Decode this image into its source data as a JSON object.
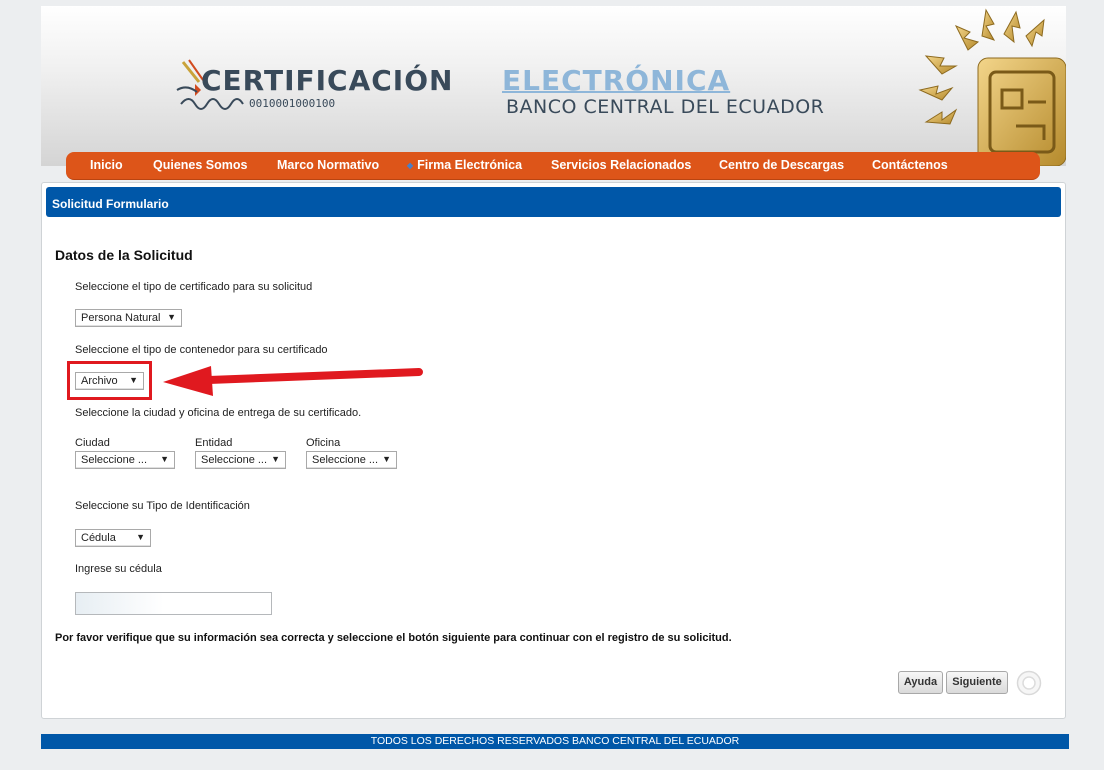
{
  "banner": {
    "title_part1": "CERTIFICACIÓN",
    "title_part2": "ELECTRÓNICA",
    "code": "0010001000100",
    "subtitle": "BANCO CENTRAL DEL ECUADOR"
  },
  "nav": {
    "items": [
      {
        "label": "Inicio"
      },
      {
        "label": "Quienes Somos"
      },
      {
        "label": "Marco Normativo"
      },
      {
        "label": "Firma Electrónica",
        "active": true
      },
      {
        "label": "Servicios Relacionados"
      },
      {
        "label": "Centro de Descargas"
      },
      {
        "label": "Contáctenos"
      }
    ]
  },
  "panel": {
    "header": "Solicitud Formulario",
    "section_title": "Datos de la Solicitud",
    "cert_type": {
      "label": "Seleccione el tipo de certificado para su solicitud",
      "value": "Persona Natural"
    },
    "container_type": {
      "label": "Seleccione el tipo de contenedor para su certificado",
      "value": "Archivo"
    },
    "delivery": {
      "label": "Seleccione la ciudad y oficina de entrega de su certificado.",
      "ciudad_label": "Ciudad",
      "ciudad_value": "Seleccione ...",
      "entidad_label": "Entidad",
      "entidad_value": "Seleccione ...",
      "oficina_label": "Oficina",
      "oficina_value": "Seleccione ..."
    },
    "id_type": {
      "label": "Seleccione su Tipo de Identificación",
      "value": "Cédula"
    },
    "cedula": {
      "label": "Ingrese su cédula",
      "value": "",
      "placeholder": ""
    },
    "notice": "Por favor verifique que su información sea correcta y seleccione el botón siguiente para continuar con el registro de su solicitud.",
    "buttons": {
      "help": "Ayuda",
      "next": "Siguiente"
    }
  },
  "footer": "TODOS LOS DERECHOS RESERVADOS BANCO CENTRAL DEL ECUADOR",
  "colors": {
    "nav_bg": "#dd5519",
    "header_blue": "#0057a8",
    "highlight_red": "#e0191f"
  }
}
